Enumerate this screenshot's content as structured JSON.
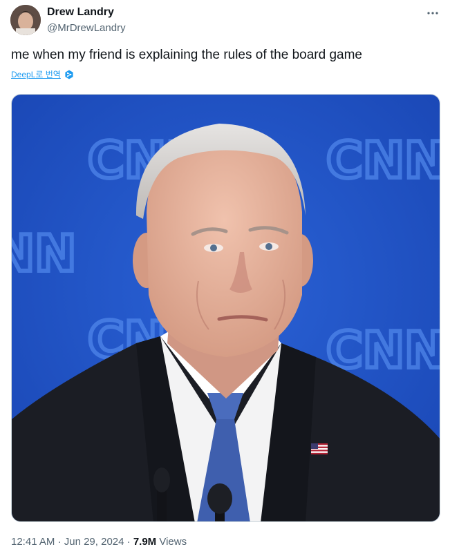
{
  "author": {
    "display_name": "Drew Landry",
    "handle": "@MrDrewLandry"
  },
  "tweet": {
    "text": "me when my friend is explaining the rules of the board game",
    "translate_label": "DeepL로 번역"
  },
  "media": {
    "backdrop_logos": [
      "CNN",
      "CNN",
      "CNN",
      "CNN",
      "CNN"
    ],
    "colors": {
      "backdrop": "#1f52c8",
      "suit": "#1b1d24",
      "tie": "#3f5fae"
    }
  },
  "meta": {
    "time": "12:41 AM",
    "date": "Jun 29, 2024",
    "separator": "·",
    "views_count": "7.9M",
    "views_label": "Views"
  },
  "icons": {
    "more": "more-dots-icon",
    "translate": "deepl-logo-icon"
  }
}
